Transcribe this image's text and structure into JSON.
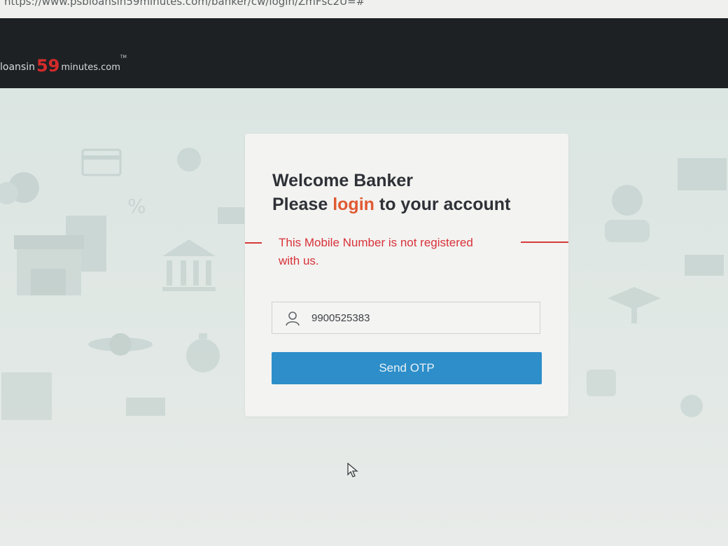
{
  "browser": {
    "url": "https://www.psbloansin59minutes.com/banker/cw/login/ZmFsc2U=#"
  },
  "header": {
    "logo": {
      "prefix": "loansin",
      "number": "59",
      "suffix": "minutes.com",
      "trademark": "TM"
    }
  },
  "login_card": {
    "welcome_line1": "Welcome Banker",
    "please": "Please",
    "login_word": "login",
    "to_your_account": "to your account",
    "error_message": "This Mobile Number is not registered with us.",
    "mobile_value": "9900525383",
    "send_otp_label": "Send OTP"
  },
  "colors": {
    "accent_orange": "#e05a33",
    "error_red": "#d8323a",
    "button_blue": "#2d8ec9",
    "header_dark": "#1e2124"
  },
  "icons": {
    "field_icon": "user-icon",
    "pointer": "mouse-cursor-icon"
  }
}
